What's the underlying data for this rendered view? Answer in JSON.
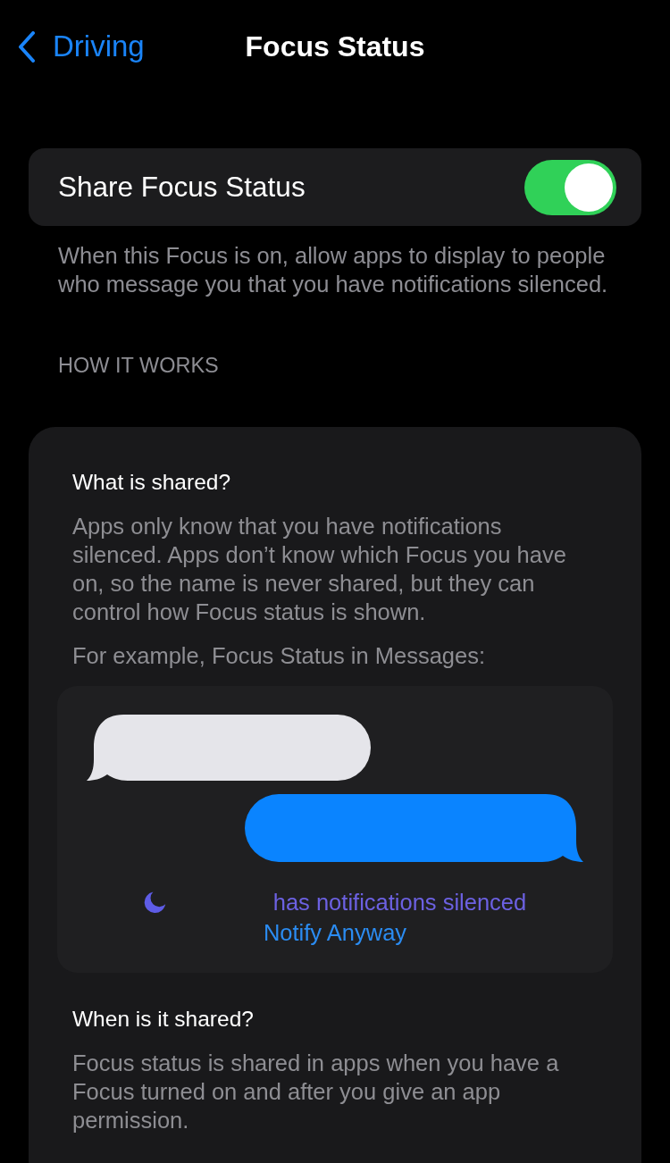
{
  "nav": {
    "back": "Driving",
    "title": "Focus Status"
  },
  "share_toggle": {
    "label": "Share Focus Status",
    "on": true
  },
  "share_footer": "When this Focus is on, allow apps to display to people who message you that you have notifications silenced.",
  "section_header": "HOW IT WORKS",
  "how_it_works": [
    {
      "kind": "heading",
      "text": "What is shared?"
    },
    {
      "kind": "paragraph",
      "text": "Apps only know that you have notifications silenced. Apps don’t know which Focus you have on, so the name is never shared, but they can control how Focus status is shown."
    },
    {
      "kind": "paragraph",
      "text": "For example, Focus Status in Messages:"
    },
    {
      "kind": "preview",
      "status": "has notifications silenced",
      "action": "Notify Anyway"
    },
    {
      "kind": "heading",
      "text": "When is it shared?"
    },
    {
      "kind": "paragraph",
      "text": "Focus status is shared in apps when you have a Focus turned on and after you give an app permission."
    }
  ]
}
